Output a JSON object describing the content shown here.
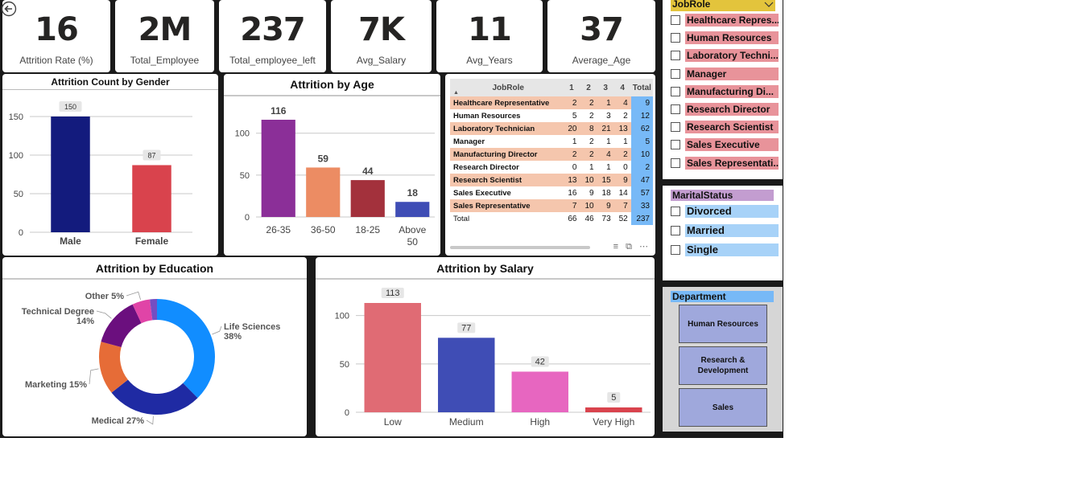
{
  "kpis": [
    {
      "value": "16",
      "label": "Attrition Rate (%)"
    },
    {
      "value": "2M",
      "label": "Total_Employee"
    },
    {
      "value": "237",
      "label": "Total_employee_left"
    },
    {
      "value": "7K",
      "label": "Avg_Salary"
    },
    {
      "value": "11",
      "label": "Avg_Years"
    },
    {
      "value": "37",
      "label": "Average_Age"
    }
  ],
  "icons": {
    "back": "back-arrow-icon",
    "checkbox": "checkbox-icon",
    "chevron": "chevron-down-icon",
    "filter": "filter-icon",
    "focus": "focus-mode-icon",
    "more": "more-options-icon"
  },
  "matrix": {
    "headers": [
      "JobRole",
      "1",
      "2",
      "3",
      "4",
      "Total"
    ],
    "rows": [
      {
        "role": "Healthcare Representative",
        "v": [
          "2",
          "2",
          "1",
          "4"
        ],
        "total": "9"
      },
      {
        "role": "Human Resources",
        "v": [
          "5",
          "2",
          "3",
          "2"
        ],
        "total": "12"
      },
      {
        "role": "Laboratory Technician",
        "v": [
          "20",
          "8",
          "21",
          "13"
        ],
        "total": "62"
      },
      {
        "role": "Manager",
        "v": [
          "1",
          "2",
          "1",
          "1"
        ],
        "total": "5"
      },
      {
        "role": "Manufacturing Director",
        "v": [
          "2",
          "2",
          "4",
          "2"
        ],
        "total": "10"
      },
      {
        "role": "Research Director",
        "v": [
          "0",
          "1",
          "1",
          "0"
        ],
        "total": "2"
      },
      {
        "role": "Research Scientist",
        "v": [
          "13",
          "10",
          "15",
          "9"
        ],
        "total": "47"
      },
      {
        "role": "Sales Executive",
        "v": [
          "16",
          "9",
          "18",
          "14"
        ],
        "total": "57"
      },
      {
        "role": "Sales Representative",
        "v": [
          "7",
          "10",
          "9",
          "7"
        ],
        "total": "33"
      }
    ],
    "total_row": {
      "label": "Total",
      "v": [
        "66",
        "46",
        "73",
        "52"
      ],
      "total": "237"
    },
    "tools": "≡ ▪ ⧉ ▪ ⋯"
  },
  "slicers": {
    "jobrole": {
      "title": "JobRole",
      "items": [
        "Healthcare Repres...",
        "Human Resources",
        "Laboratory Techni...",
        "Manager",
        "Manufacturing Di...",
        "Research Director",
        "Research Scientist",
        "Sales Executive",
        "Sales Representati..."
      ]
    },
    "marital": {
      "title": "MaritalStatus",
      "items": [
        "Divorced",
        "Married",
        "Single"
      ]
    },
    "department": {
      "title": "Department",
      "items": [
        "Human Resources",
        "Research & Development",
        "Sales"
      ]
    }
  },
  "colors": {
    "navy": "#131b7d",
    "red": "#d9434d",
    "purple": "#8b2f98",
    "orange": "#ec8c63",
    "maroon": "#a3313c",
    "blue": "#3f4db5",
    "pink_highlight": "#f5c6ad",
    "total_blue": "#77b9f7",
    "slicer_pink": "#e8939a",
    "slicer_blue": "#a7d2f8",
    "dept_blue": "#9fa8dc",
    "yellow_head": "#e3c43c"
  },
  "chart_data": [
    {
      "type": "bar",
      "title": "Attrition Count by Gender",
      "categories": [
        "Male",
        "Female"
      ],
      "values": [
        150,
        87
      ],
      "colors": [
        "#131b7d",
        "#d9434d"
      ],
      "ylim": [
        0,
        150
      ],
      "yticks": [
        0,
        50,
        100,
        150
      ],
      "grid": true
    },
    {
      "type": "bar",
      "title": "Attrition by Age",
      "categories": [
        "26-35",
        "36-50",
        "18-25",
        "Above 50"
      ],
      "values": [
        116,
        59,
        44,
        18
      ],
      "colors": [
        "#8b2f98",
        "#ec8c63",
        "#a3313c",
        "#3f4db5"
      ],
      "ylim": [
        0,
        116
      ],
      "yticks": [
        0,
        50,
        100
      ],
      "grid": true
    },
    {
      "type": "pie",
      "title": "Attrition by Education",
      "slices": [
        {
          "label": "Life Sciences",
          "pct": "38%",
          "value": 38,
          "color": "#118dff"
        },
        {
          "label": "Medical",
          "pct": "27%",
          "value": 27,
          "color": "#1f2aa3"
        },
        {
          "label": "Marketing",
          "pct": "15%",
          "value": 15,
          "color": "#e66c37"
        },
        {
          "label": "Technical Degree",
          "pct": "14%",
          "value": 14,
          "color": "#6b0f7e"
        },
        {
          "label": "Other",
          "pct": "5%",
          "value": 5,
          "color": "#e044a7"
        },
        {
          "label": "",
          "pct": "",
          "value": 2,
          "color": "#744ec2"
        }
      ]
    },
    {
      "type": "bar",
      "title": "Attrition by Salary",
      "categories": [
        "Low",
        "Medium",
        "High",
        "Very High"
      ],
      "values": [
        113,
        77,
        42,
        5
      ],
      "colors": [
        "#e06b74",
        "#3f4db5",
        "#e766c0",
        "#d9434d"
      ],
      "ylim": [
        0,
        113
      ],
      "yticks": [
        0,
        50,
        100
      ],
      "grid": true
    }
  ]
}
